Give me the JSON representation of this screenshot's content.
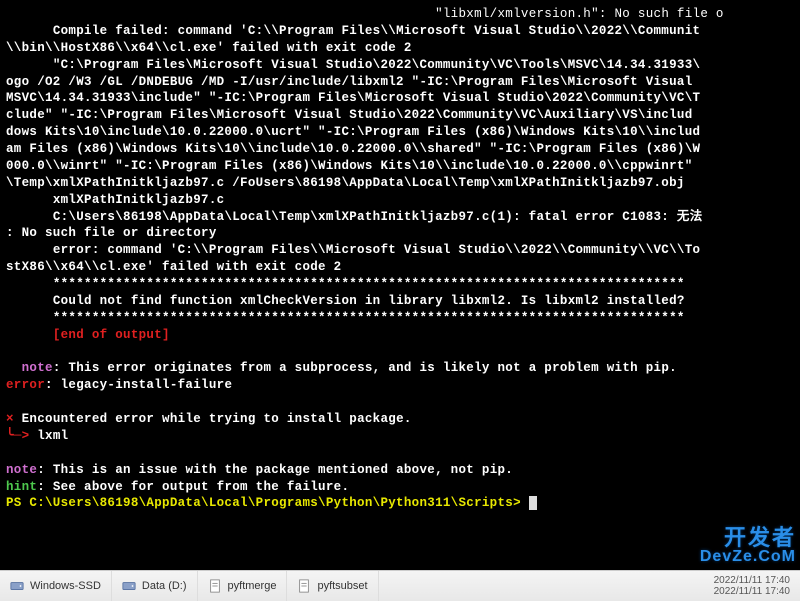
{
  "term": {
    "l1": "      Compile failed: command 'C:\\\\Program Files\\\\Microsoft Visual Studio\\\\2022\\\\Communit",
    "l2": "\\\\bin\\\\HostX86\\\\x64\\\\cl.exe' failed with exit code 2",
    "l3": "      \"C:\\Program Files\\Microsoft Visual Studio\\2022\\Community\\VC\\Tools\\MSVC\\14.34.31933\\",
    "l4": "ogo /O2 /W3 /GL /DNDEBUG /MD -I/usr/include/libxml2 \"-IC:\\Program Files\\Microsoft Visual ",
    "l5": "MSVC\\14.34.31933\\include\" \"-IC:\\Program Files\\Microsoft Visual Studio\\2022\\Community\\VC\\T",
    "l6": "clude\" \"-IC:\\Program Files\\Microsoft Visual Studio\\2022\\Community\\VC\\Auxiliary\\VS\\includ",
    "l7": "dows Kits\\10\\include\\10.0.22000.0\\ucrt\" \"-IC:\\Program Files (x86)\\Windows Kits\\10\\\\includ",
    "l8": "am Files (x86)\\Windows Kits\\10\\\\include\\10.0.22000.0\\\\shared\" \"-IC:\\Program Files (x86)\\W",
    "l9": "000.0\\\\winrt\" \"-IC:\\Program Files (x86)\\Windows Kits\\10\\\\include\\10.0.22000.0\\\\cppwinrt\"",
    "l10": "\\Temp\\xmlXPathInitkljazb97.c /FoUsers\\86198\\AppData\\Local\\Temp\\xmlXPathInitkljazb97.obj",
    "l11": "      xmlXPathInitkljazb97.c",
    "l12": "      C:\\Users\\86198\\AppData\\Local\\Temp\\xmlXPathInitkljazb97.c(1): fatal error C1083: 无法",
    "l13": ": No such file or directory",
    "l14": "      error: command 'C:\\\\Program Files\\\\Microsoft Visual Studio\\\\2022\\\\Community\\\\VC\\\\To",
    "l15": "stX86\\\\x64\\\\cl.exe' failed with exit code 2",
    "l16": "      *********************************************************************************",
    "l17": "      Could not find function xmlCheckVersion in library libxml2. Is libxml2 installed?",
    "l18": "      *********************************************************************************",
    "end_of_output": "      [end of output]",
    "header_file": "\"libxml/xmlversion.h\": No such file o",
    "note1_label": "  note",
    "note1_text": ": This error originates from a subprocess, and is likely not a problem with pip.",
    "error_label": "error",
    "error_text": ": legacy-install-failure",
    "enc_prefix": "×",
    "enc_text": " Encountered error while trying to install package.",
    "enc_arrow": "╰─> ",
    "enc_pkg": "lxml",
    "note2_label": "note",
    "note2_text": ": This is an issue with the package mentioned above, not pip.",
    "hint_label": "hint",
    "hint_text": ": See above for output from the failure.",
    "prompt": "PS C:\\Users\\86198\\AppData\\Local\\Programs\\Python\\Python311\\Scripts> "
  },
  "taskbar": {
    "item1": "Windows-SSD",
    "item2": "Data (D:)",
    "file1": "pyftmerge",
    "file2": "pyftsubset",
    "time": "2022/11/11 17:40"
  },
  "watermark": {
    "cn": "开发者",
    "en": "DevZe.CoM"
  }
}
